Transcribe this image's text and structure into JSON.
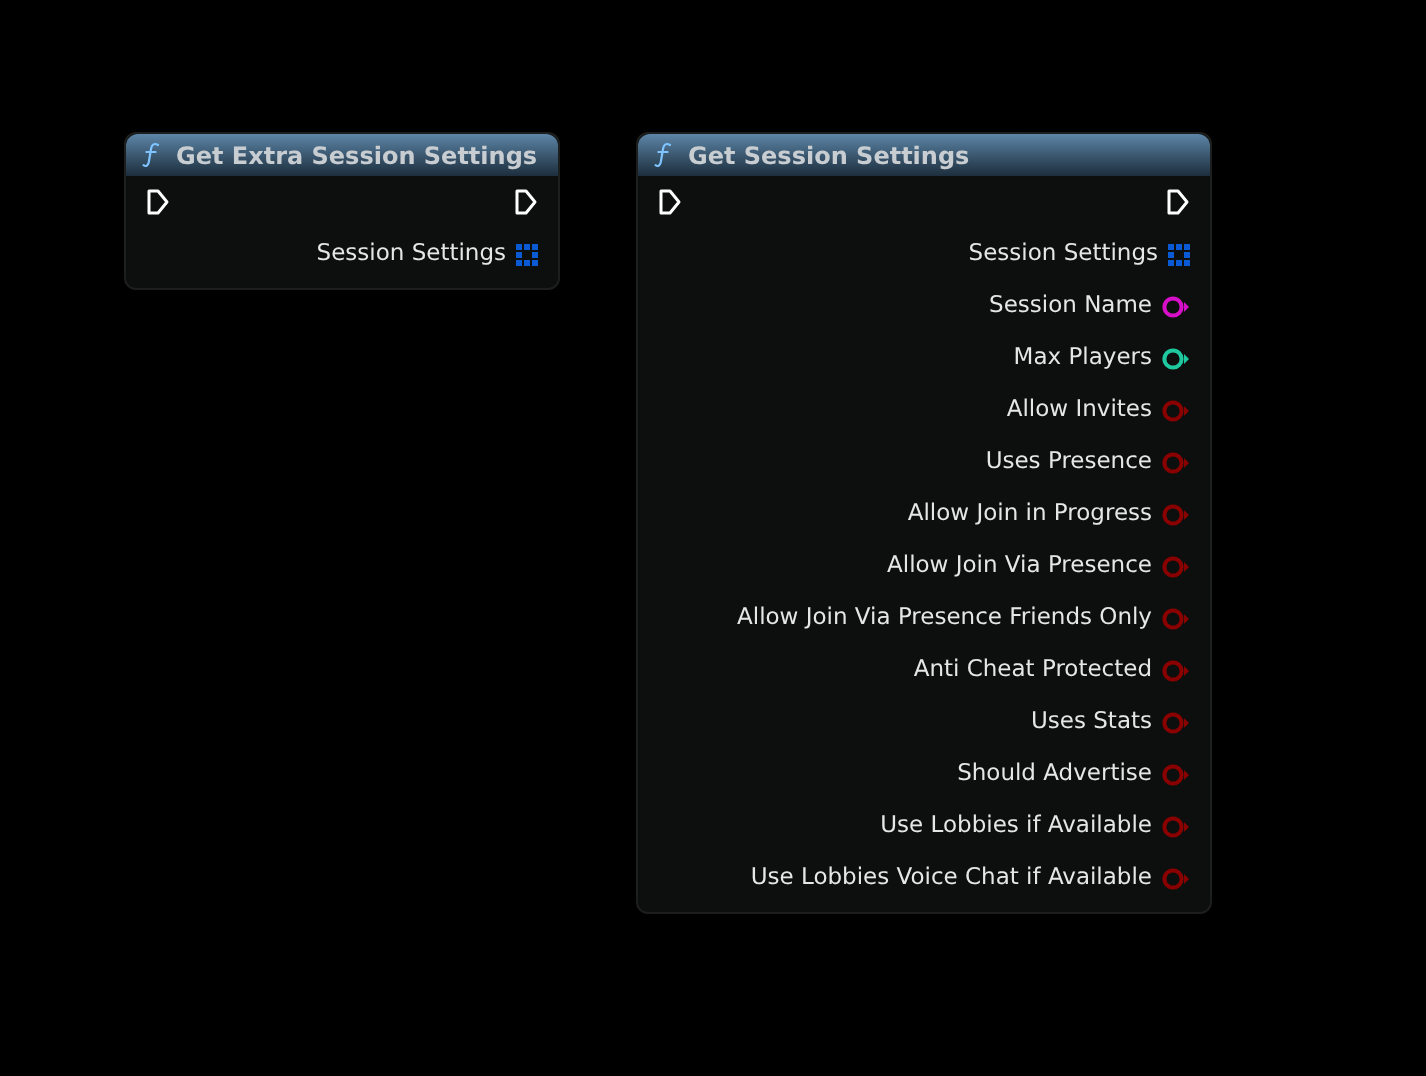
{
  "nodes": [
    {
      "title": "Get Extra Session Settings",
      "pins": [
        {
          "label": "Session Settings",
          "kind": "struct",
          "color": "#0a5ad4"
        }
      ]
    },
    {
      "title": "Get Session Settings",
      "pins": [
        {
          "label": "Session Settings",
          "kind": "struct",
          "color": "#0a5ad4"
        },
        {
          "label": "Session Name",
          "kind": "value",
          "color": "#d80fc8"
        },
        {
          "label": "Max Players",
          "kind": "value",
          "color": "#1fc9a0"
        },
        {
          "label": "Allow Invites",
          "kind": "value",
          "color": "#8a0000"
        },
        {
          "label": "Uses Presence",
          "kind": "value",
          "color": "#8a0000"
        },
        {
          "label": "Allow Join in Progress",
          "kind": "value",
          "color": "#8a0000"
        },
        {
          "label": "Allow Join Via Presence",
          "kind": "value",
          "color": "#8a0000"
        },
        {
          "label": "Allow Join Via Presence Friends Only",
          "kind": "value",
          "color": "#8a0000"
        },
        {
          "label": "Anti Cheat Protected",
          "kind": "value",
          "color": "#8a0000"
        },
        {
          "label": "Uses Stats",
          "kind": "value",
          "color": "#8a0000"
        },
        {
          "label": "Should Advertise",
          "kind": "value",
          "color": "#8a0000"
        },
        {
          "label": "Use Lobbies if Available",
          "kind": "value",
          "color": "#8a0000"
        },
        {
          "label": "Use Lobbies Voice Chat if Available",
          "kind": "value",
          "color": "#8a0000"
        }
      ]
    }
  ]
}
